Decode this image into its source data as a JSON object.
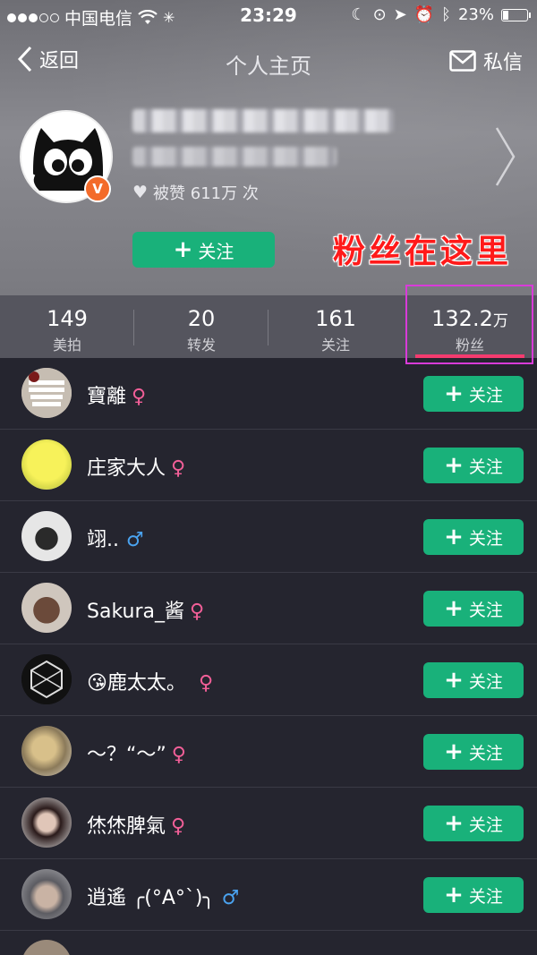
{
  "status_bar": {
    "carrier": "中国电信",
    "time": "23:29",
    "battery": "23%",
    "battery_level": 0.23
  },
  "nav": {
    "back_label": "返回",
    "title": "个人主页",
    "message_label": "私信"
  },
  "profile": {
    "likes_text": "被赞 611万 次",
    "verified_badge": "V",
    "follow_label": "关注"
  },
  "annotation": "粉丝在这里",
  "stats": [
    {
      "num": "149",
      "label": "美拍"
    },
    {
      "num": "20",
      "label": "转发"
    },
    {
      "num": "161",
      "label": "关注"
    },
    {
      "num": "132.2",
      "unit": "万",
      "label": "粉丝"
    }
  ],
  "followers": [
    {
      "name": "寶離",
      "gender": "♀",
      "avatar_color": "#b9b0a6",
      "avatar_text": "KEEP CALM AND BE BAD"
    },
    {
      "name": "庄家大人",
      "gender": "♀",
      "avatar_color": "#e9e84a"
    },
    {
      "name": "翊..",
      "gender": "♂",
      "avatar_color": "#dedede"
    },
    {
      "name": "Sakura_酱",
      "gender": "♀",
      "avatar_color": "#8b6b58"
    },
    {
      "name": "😘鹿太太。",
      "gender": "♀",
      "avatar_color": "#111111"
    },
    {
      "name": "～？“～”",
      "gender": "♀",
      "avatar_color": "#b59a6c"
    },
    {
      "name": "烋烋脾氣",
      "gender": "♀",
      "avatar_color": "#3a2a2a"
    },
    {
      "name": "逍遙 ╭(°A°`)╮",
      "gender": "♂",
      "avatar_color": "#7d7d84"
    }
  ],
  "follow_button_label": "关注",
  "colors": {
    "accent_green": "#19b17a",
    "female": "#f25f98",
    "male": "#4aa3f0",
    "annotation_red": "#ff1a1a",
    "highlight_box": "#d93bd9",
    "active_underline": "#f43b6f"
  }
}
